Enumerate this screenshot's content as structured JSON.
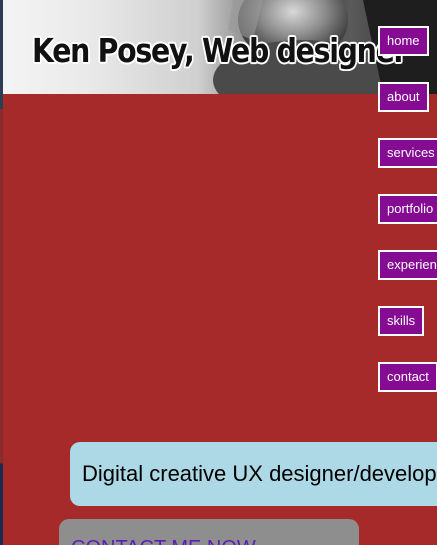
{
  "header": {
    "title": "Ken Posey, Web designer"
  },
  "nav": {
    "items": [
      {
        "label": "home"
      },
      {
        "label": "about"
      },
      {
        "label": "services"
      },
      {
        "label": "portfolio"
      },
      {
        "label": "experience"
      },
      {
        "label": "skills"
      },
      {
        "label": "contact"
      }
    ]
  },
  "intro": {
    "text": "Digital creative UX designer/developer"
  },
  "contact": {
    "label": "CONTACT ME NOW"
  },
  "colors": {
    "page_background": "#a62a2a",
    "nav_background": "#850b93",
    "nav_border": "#ffffff",
    "intro_background": "#add8e6",
    "contact_background": "#8e8e8e",
    "contact_link": "#5a1eb8"
  }
}
